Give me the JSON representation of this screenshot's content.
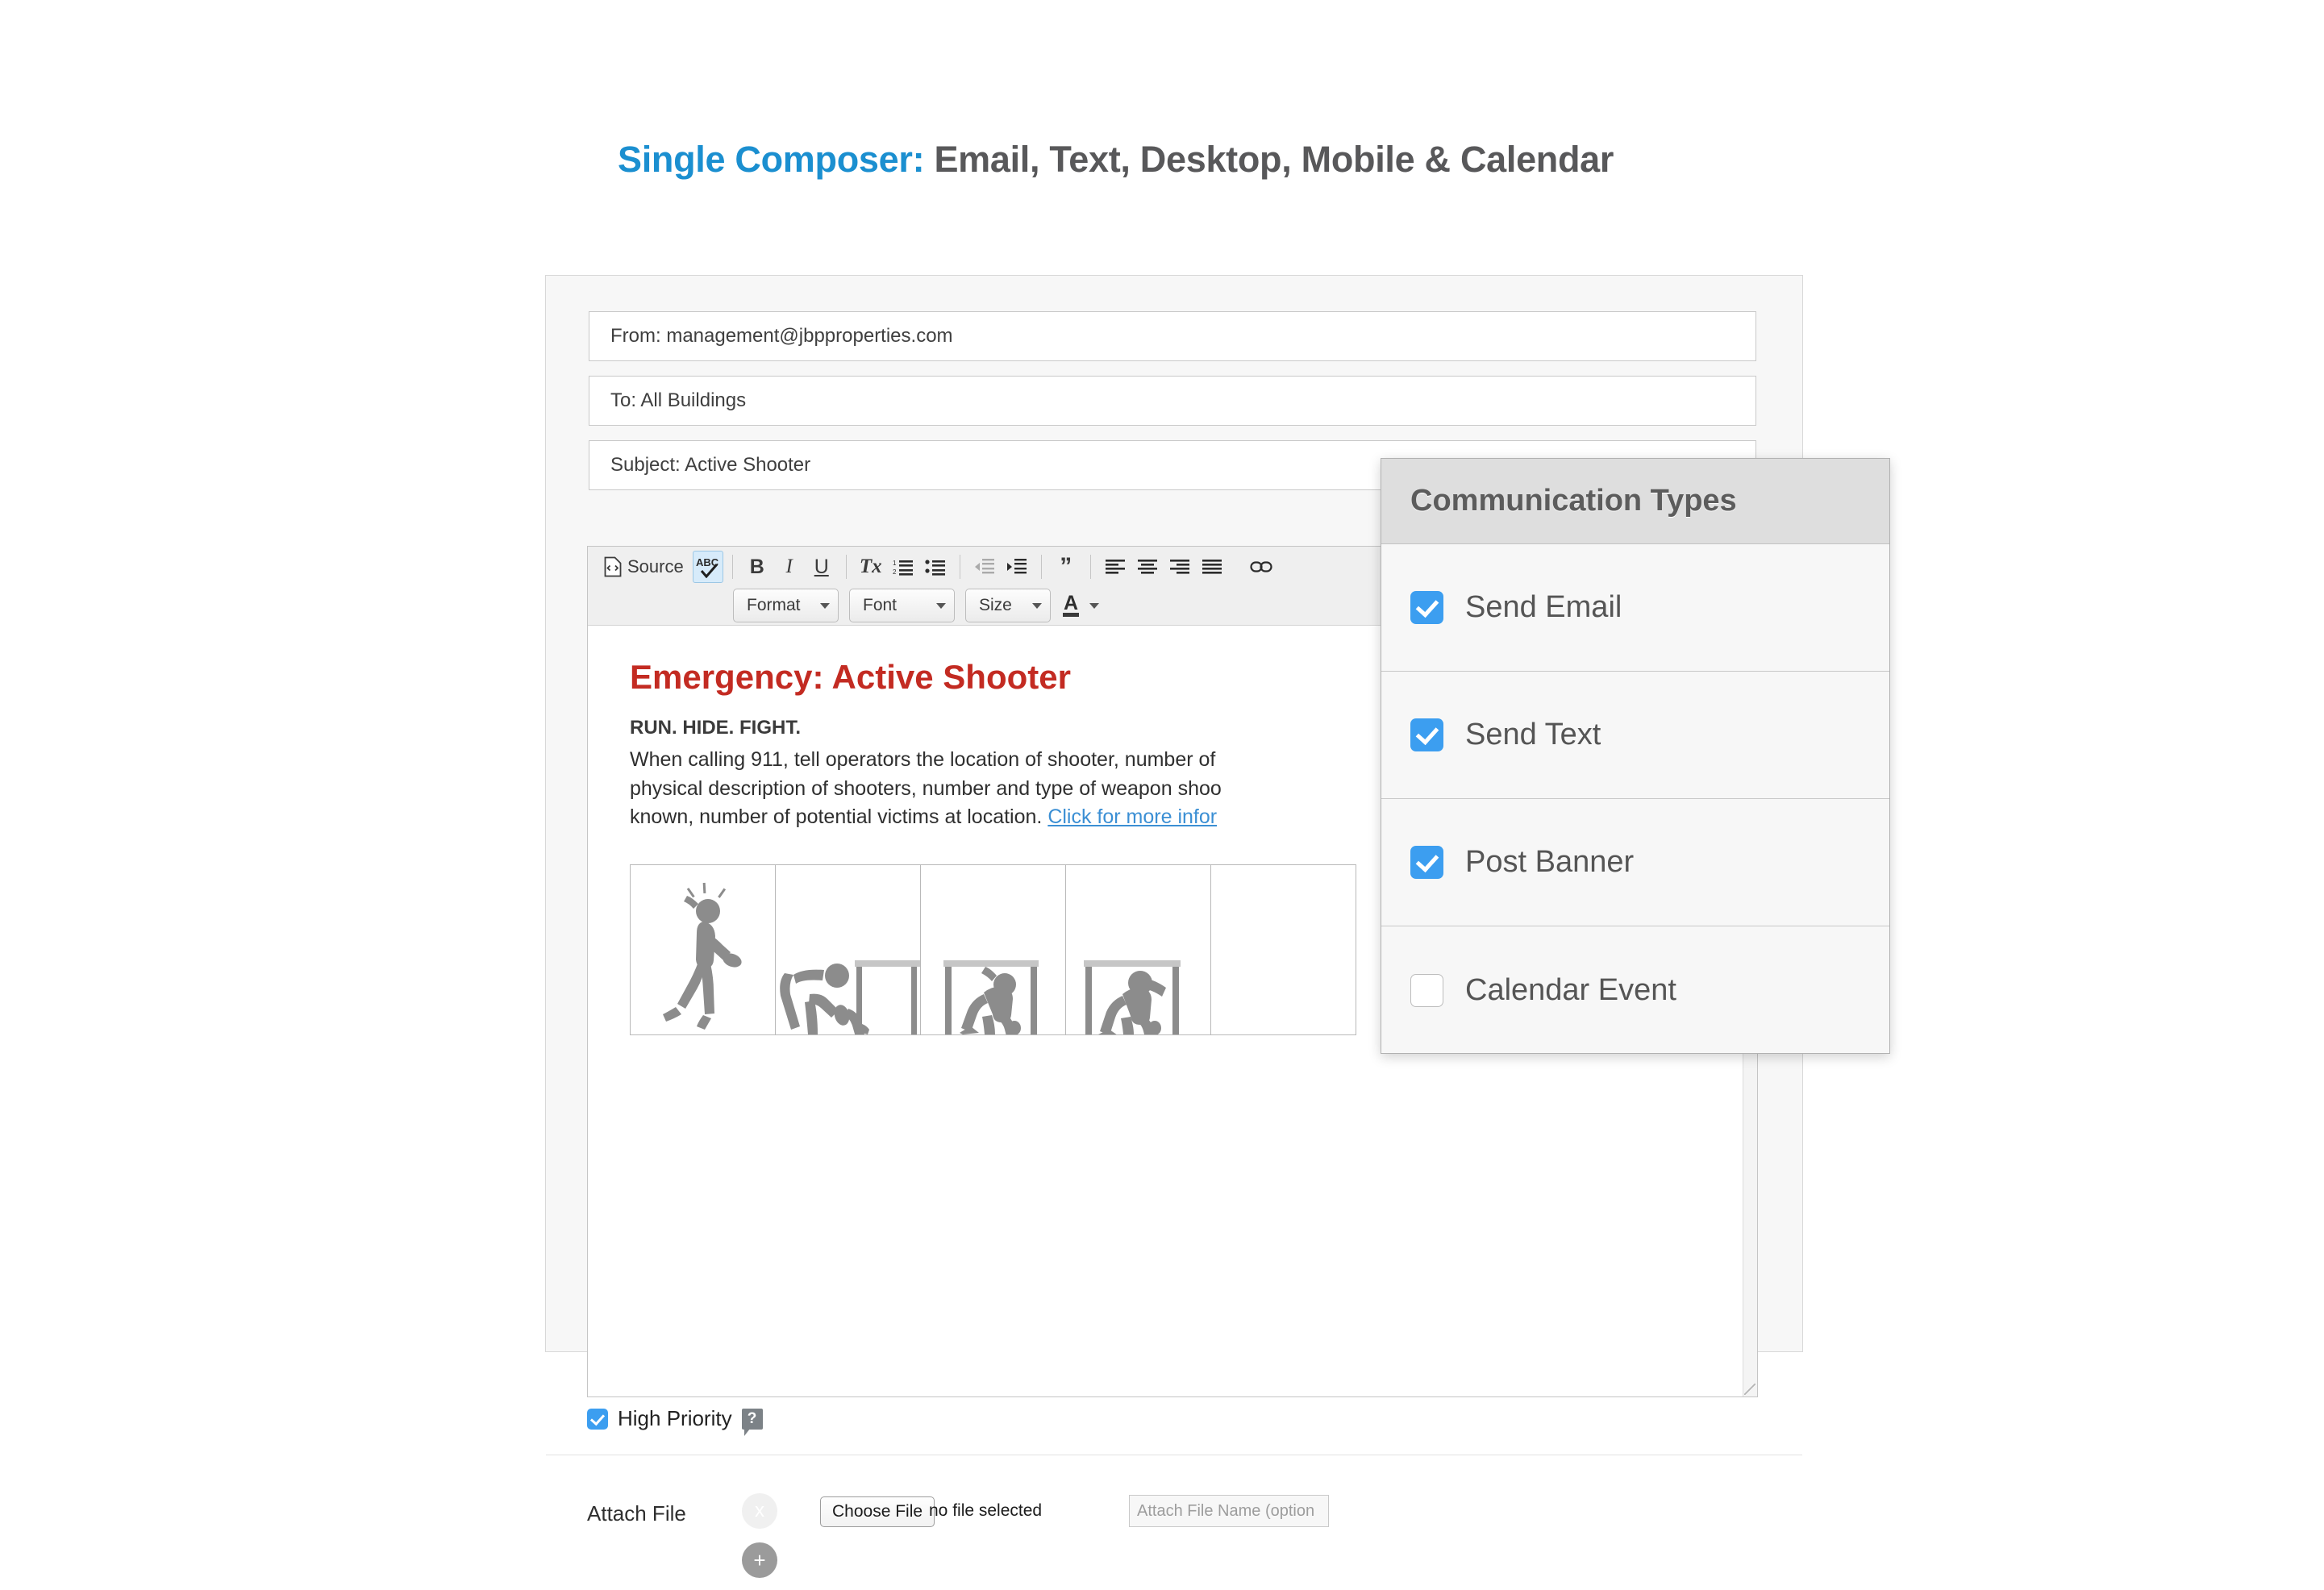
{
  "page": {
    "title_accent": "Single Composer:",
    "title_rest": " Email, Text, Desktop, Mobile & Calendar",
    "accent_color": "#1b8fd0",
    "title_color": "#58585a"
  },
  "composer": {
    "fields": {
      "from": "From: management@jbpproperties.com",
      "to": "To: All Buildings",
      "subject": "Subject: Active Shooter"
    },
    "toolbar": {
      "source_label": "Source",
      "spellcheck_label": "ABC",
      "bold_label": "B",
      "italic_label": "I",
      "underline_label": "U",
      "remove_format_label": "Tx",
      "numbered_list_icon": "numbered-list-icon",
      "bulleted_list_icon": "bulleted-list-icon",
      "outdent_icon": "outdent-icon",
      "indent_icon": "indent-icon",
      "blockquote_label": "”",
      "align_left_icon": "align-left-icon",
      "align_center_icon": "align-center-icon",
      "align_right_icon": "align-right-icon",
      "align_justify_icon": "align-justify-icon",
      "link_icon": "link-icon",
      "format_select": "Format",
      "font_select": "Font",
      "size_select": "Size",
      "text_color_label": "A"
    },
    "message": {
      "title": "Emergency: Active Shooter",
      "title_color": "#c32b22",
      "subtitle": "RUN. HIDE. FIGHT.",
      "body_part1": "When calling 911, tell operators the location of shooter, number of ",
      "body_part2": "physical description of shooters, number and type of weapon shoo",
      "body_part3": "known, number of potential victims at location. ",
      "body_link": "Click for more infor",
      "link_color": "#3b8fd4",
      "figures": [
        "running-person-icon",
        "person-hiding-under-table-icon",
        "person-hiding-under-table-icon",
        "person-hiding-under-table-icon",
        "empty-figure-cell"
      ]
    },
    "priority": {
      "label": "High Priority",
      "checked": true,
      "help_icon": "help-question-icon"
    },
    "attach": {
      "label": "Attach File",
      "remove_label": "x",
      "add_label": "+",
      "choose_file_label": "Choose File",
      "no_file_text": "no file selected",
      "name_placeholder": "Attach File Name (option"
    }
  },
  "comm_panel": {
    "header": "Communication Types",
    "items": [
      {
        "label": "Send Email",
        "checked": true
      },
      {
        "label": "Send Text",
        "checked": true
      },
      {
        "label": "Post Banner",
        "checked": true
      },
      {
        "label": "Calendar Event",
        "checked": false
      }
    ]
  }
}
